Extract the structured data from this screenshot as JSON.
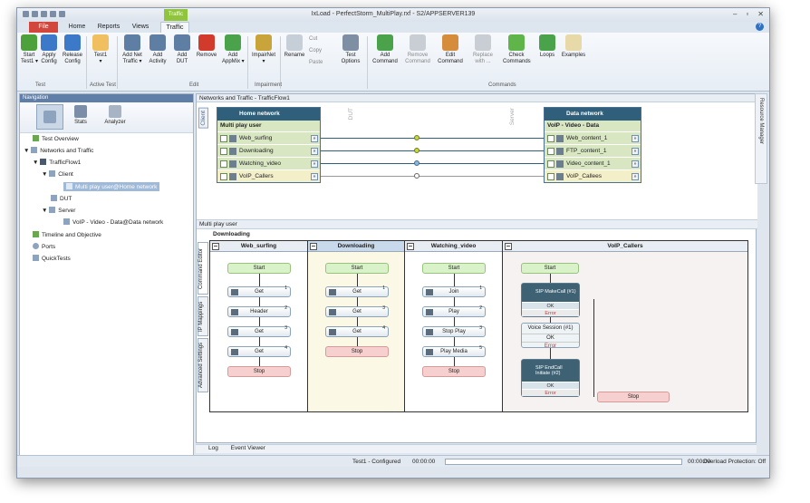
{
  "window": {
    "title": "IxLoad - PerfectStorm_MultiPlay.rxf - S2/APPSERVER139",
    "context_tab": "Traffic",
    "file_tab": "File"
  },
  "tabs": [
    "Home",
    "Reports",
    "Views",
    "Traffic"
  ],
  "ribbon": {
    "buttons": [
      {
        "label": "Start\nTest1 ▾"
      },
      {
        "label": "Apply\nConfig"
      },
      {
        "label": "Release\nConfig"
      },
      {
        "label": "Test1\n▾"
      },
      {
        "label": "Add Net\nTraffic ▾"
      },
      {
        "label": "Add\nActivity"
      },
      {
        "label": "Add\nDUT"
      },
      {
        "label": "Remove"
      },
      {
        "label": "Add\nAppMix ▾"
      },
      {
        "label": "ImpairNet\n▾"
      },
      {
        "label": "Rename"
      },
      {
        "label": "Test\nOptions"
      },
      {
        "label": "Add\nCommand"
      },
      {
        "label": "Remove\nCommand"
      },
      {
        "label": "Edit\nCommand"
      },
      {
        "label": "Replace\nwith ..."
      },
      {
        "label": "Check\nCommands"
      },
      {
        "label": "Loops"
      },
      {
        "label": "Examples"
      }
    ],
    "small": [
      "Cut",
      "Copy",
      "Paste"
    ],
    "groups": [
      "Test",
      "Active Test",
      "Edit",
      "Impairment",
      "Commands"
    ]
  },
  "nav": {
    "header": "Navigation",
    "stats": "Stats",
    "analyzer": "Analyzer",
    "items": [
      "Test Overview",
      "Networks and Traffic",
      "TrafficFlow1",
      "Client",
      "Multi play user@Home network",
      "DUT",
      "Server",
      "VoIP - Video - Data@Data network",
      "Timeline and Objective",
      "Ports",
      "QuickTests"
    ]
  },
  "flow": {
    "header": "Networks and Traffic - TrafficFlow1",
    "client_label": "Client",
    "dut_label": "DUT",
    "server_label": "Server",
    "client": {
      "network": "Home network",
      "user": "Multi play user",
      "rows": [
        "Web_surfing",
        "Downloading",
        "Watching_video",
        "VoIP_Callers"
      ]
    },
    "server": {
      "network": "Data network",
      "user": "VoIP - Video - Data",
      "rows": [
        "Web_content_1",
        "FTP_content_1",
        "Video_content_1",
        "VoIP_Callees"
      ]
    }
  },
  "editor": {
    "header": "Multi play user",
    "title": "Downloading",
    "side_tabs": [
      "Command Editor",
      "IP Mappings",
      "Advanced Settings"
    ],
    "columns": [
      {
        "name": "Web_surfing",
        "nodes": [
          "Start",
          "Get",
          "Header",
          "Get",
          "Get",
          "Stop"
        ],
        "nums": [
          "",
          "1",
          "2",
          "3",
          "4",
          ""
        ]
      },
      {
        "name": "Downloading",
        "nodes": [
          "Start",
          "Get",
          "Get",
          "Get",
          "Stop"
        ],
        "nums": [
          "",
          "1",
          "3",
          "4",
          ""
        ]
      },
      {
        "name": "Watching_video",
        "nodes": [
          "Start",
          "Join",
          "Play",
          "Stop Play",
          "Play Media",
          "Stop"
        ],
        "nums": [
          "",
          "1",
          "2",
          "3",
          "5",
          ""
        ]
      },
      {
        "name": "VoIP_Callers",
        "nodes": [
          "Start",
          "SIP MakeCall (#1)",
          "Voice Session (#1)",
          "SIP EndCall Initiate (#2)",
          "Stop"
        ],
        "ok": "OK",
        "err": "Error"
      }
    ]
  },
  "bottom_tabs": [
    "Log",
    "Event Viewer"
  ],
  "status": {
    "test": "Test1 - Configured",
    "time1": "00:00:00",
    "time2": "00:00:00",
    "overload": "Overload Protection: Off"
  },
  "right_panel": "Resource Manager"
}
